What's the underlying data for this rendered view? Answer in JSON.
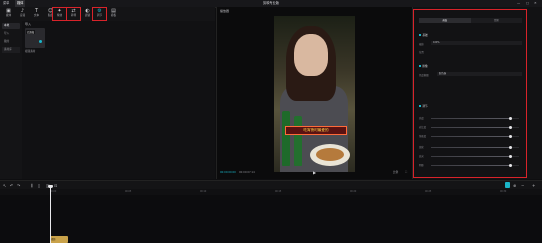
{
  "titlebar": {
    "menu_label": "菜单",
    "active_tab": "媒体",
    "title": "剪映专业版"
  },
  "toolbar": {
    "tools": [
      {
        "icon": "media-icon",
        "glyph": "▣",
        "label": "媒体"
      },
      {
        "icon": "audio-icon",
        "glyph": "♪",
        "label": "音频"
      },
      {
        "icon": "text-icon",
        "glyph": "T",
        "label": "文本"
      },
      {
        "icon": "sticker-icon",
        "glyph": "☺",
        "label": "贴纸"
      },
      {
        "icon": "effects-icon",
        "glyph": "✦",
        "label": "特效"
      },
      {
        "icon": "transition-icon",
        "glyph": "⇄",
        "label": "转场"
      },
      {
        "icon": "filter-icon",
        "glyph": "◐",
        "label": "滤镜"
      },
      {
        "icon": "adjust-icon",
        "glyph": "⚙",
        "label": "调节"
      },
      {
        "icon": "template-icon",
        "glyph": "▤",
        "label": "模板"
      }
    ]
  },
  "leftnav": {
    "items": [
      "本地",
      "导入",
      "我的",
      "素材库"
    ]
  },
  "media": {
    "tab_label": "导入",
    "thumb_badge": "已添加",
    "file_name": "视频素材"
  },
  "player": {
    "title": "播放器",
    "subtitle": "吃宵夜时最爱的",
    "time_current": "00:00:00:00",
    "time_total": "00:00:07:14",
    "ratio": "比例"
  },
  "props": {
    "tabs": [
      "画面",
      "音频"
    ],
    "sections": [
      {
        "label": "基础"
      },
      {
        "label": "抠像"
      },
      {
        "label": "调节"
      }
    ],
    "rows": [
      {
        "label": "缩放",
        "value": "100%"
      },
      {
        "label": "位置",
        "value": ""
      },
      {
        "label": "色度抠图",
        "value": "取色器"
      }
    ],
    "sliders": [
      {
        "label": "亮度",
        "level": 0.9
      },
      {
        "label": "对比度",
        "level": 0.9
      },
      {
        "label": "饱和度",
        "level": 0.9
      },
      {
        "label": "锐化",
        "level": 0.9
      },
      {
        "label": "高光",
        "level": 0.9
      },
      {
        "label": "阴影",
        "level": 0.9
      }
    ],
    "accent": "#1ab5c8",
    "highlight": "#d8232a"
  },
  "timeline": {
    "ticks": [
      "00:00",
      "00:05",
      "00:10",
      "00:15",
      "00:20",
      "00:25",
      "00:30"
    ],
    "clip_label": "视频"
  }
}
